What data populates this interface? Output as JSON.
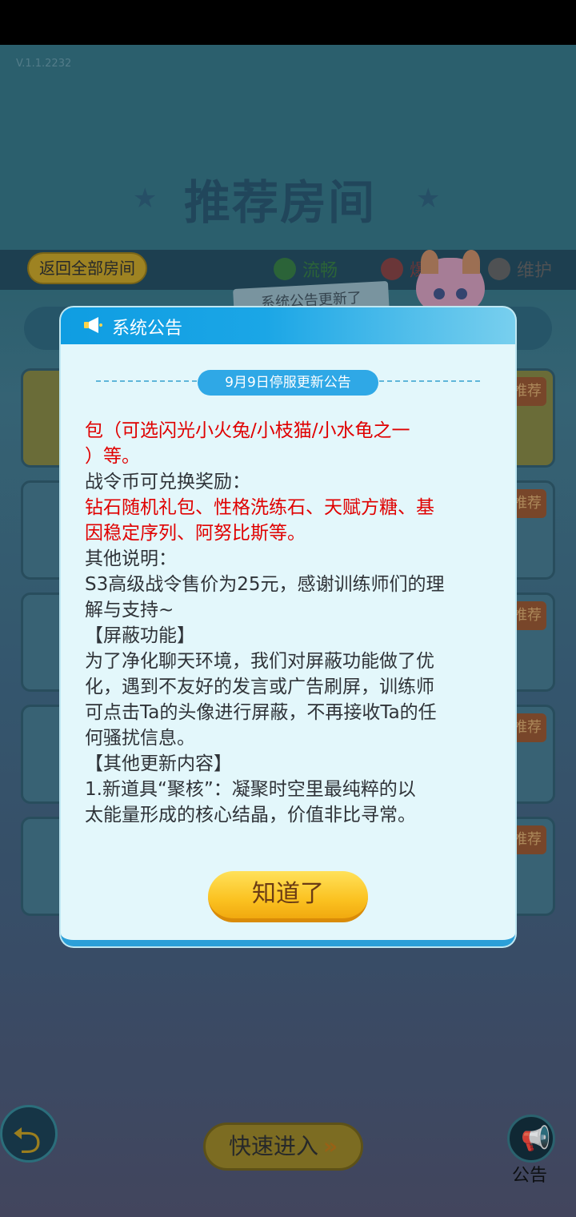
{
  "version": "V.1.1.2232",
  "page_title": "推荐房间",
  "back_all_label": "返回全部房间",
  "legend": [
    {
      "label": "流畅",
      "color": "#2f6f3a"
    },
    {
      "label": "爆满",
      "color": "#7a3a3a"
    },
    {
      "label": "维护",
      "color": "#5a5a5a"
    }
  ],
  "ribbon_text": "系统公告更新了",
  "room_tag": "推荐",
  "bottom": {
    "quick_enter": "快速进入",
    "notice_label": "公告"
  },
  "dialog": {
    "title": "系统公告",
    "subtitle": "9月9日停服更新公告",
    "lines": [
      {
        "text": "包（可选闪光小火兔/小枝猫/小水龟之一",
        "red": true
      },
      {
        "text": "）等。",
        "red": true
      },
      {
        "text": "战令币可兑换奖励：",
        "red": false
      },
      {
        "text": "钻石随机礼包、性格洗练石、天赋方糖、基",
        "red": true
      },
      {
        "text": "因稳定序列、阿努比斯等。",
        "red": true
      },
      {
        "text": "其他说明：",
        "red": false
      },
      {
        "text": "S3高级战令售价为25元，感谢训练师们的理",
        "red": false
      },
      {
        "text": "解与支持~",
        "red": false
      },
      {
        "text": "【屏蔽功能】",
        "red": false
      },
      {
        "text": "为了净化聊天环境，我们对屏蔽功能做了优",
        "red": false
      },
      {
        "text": "化，遇到不友好的发言或广告刷屏，训练师",
        "red": false
      },
      {
        "text": "可点击Ta的头像进行屏蔽，不再接收Ta的任",
        "red": false
      },
      {
        "text": "何骚扰信息。",
        "red": false
      },
      {
        "text": "【其他更新内容】",
        "red": false
      },
      {
        "text": "1.新道具“聚核”：凝聚时空里最纯粹的以",
        "red": false
      },
      {
        "text": "太能量形成的核心结晶，价值非比寻常。",
        "red": false
      }
    ],
    "ok_label": "知道了"
  }
}
